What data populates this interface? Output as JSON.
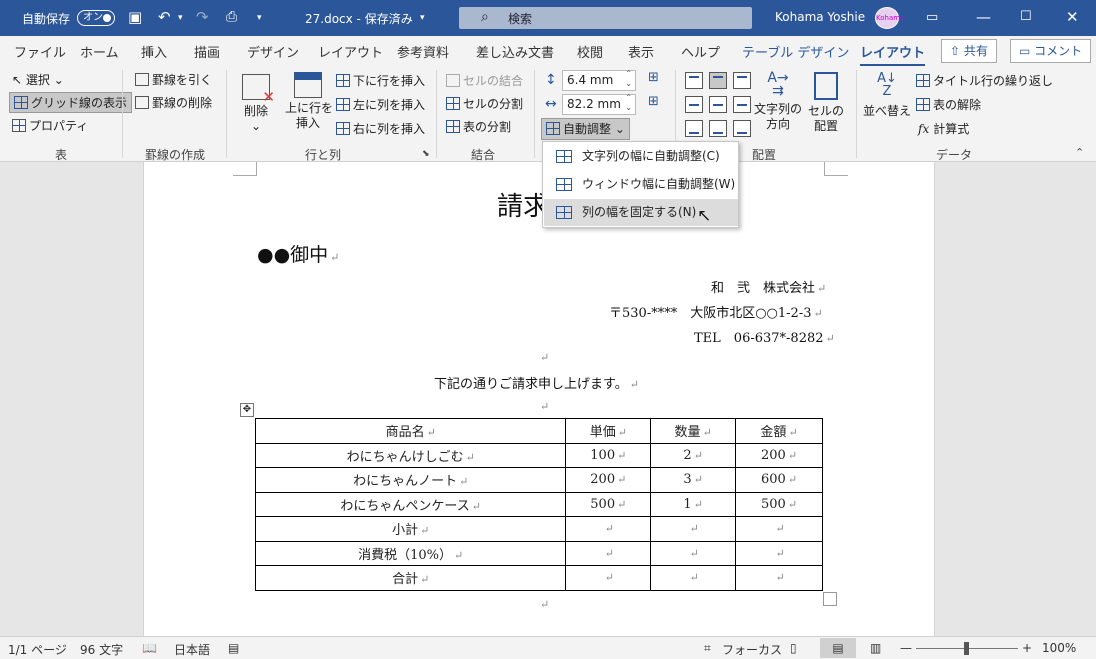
{
  "titlebar": {
    "autosave_label": "自動保存",
    "autosave_state": "オン",
    "doc_title": "27.docx - 保存済み",
    "search_placeholder": "検索",
    "user_name": "Kohama Yoshie",
    "avatar_text": "Kohama"
  },
  "tabs": [
    "ファイル",
    "ホーム",
    "挿入",
    "描画",
    "デザイン",
    "レイアウト",
    "参考資料",
    "差し込み文書",
    "校閲",
    "表示",
    "ヘルプ",
    "テーブル デザイン",
    "レイアウト"
  ],
  "share_label": "共有",
  "comment_label": "コメント",
  "ribbon": {
    "table": {
      "select": "選択",
      "gridlines": "グリッド線の表示",
      "properties": "プロパティ",
      "group": "表"
    },
    "draw": {
      "draw_table": "罫線を引く",
      "eraser": "罫線の削除",
      "group": "罫線の作成"
    },
    "rows_cols": {
      "delete": "削除",
      "insert_above_1": "上に行を",
      "insert_above_2": "挿入",
      "insert_below": "下に行を挿入",
      "insert_left": "左に列を挿入",
      "insert_right": "右に列を挿入",
      "group": "行と列"
    },
    "merge": {
      "merge_cells": "セルの結合",
      "split_cells": "セルの分割",
      "split_table": "表の分割",
      "group": "結合"
    },
    "cell_size": {
      "height": "6.4 mm",
      "width": "82.2 mm",
      "autofit": "自動調整"
    },
    "alignment": {
      "direction_1": "文字列の",
      "direction_2": "方向",
      "margins_1": "セルの",
      "margins_2": "配置",
      "group": "配置"
    },
    "data": {
      "sort_1": "並べ替え",
      "repeat_header": "タイトル行の繰り返し",
      "convert": "表の解除",
      "formula": "計算式",
      "group": "データ"
    }
  },
  "autofit_menu": [
    {
      "label": "文字列の幅に自動調整(C)"
    },
    {
      "label": "ウィンドウ幅に自動調整(W)"
    },
    {
      "label": "列の幅を固定する(N)"
    }
  ],
  "document": {
    "title": "請求",
    "addressee": "●●御中",
    "company": "和　弐　株式会社",
    "address": "〒530-****　大阪市北区○○1-2-3",
    "tel": "TEL　06-637*-8282",
    "intro": "下記の通りご請求申し上げます。",
    "table_headers": [
      "商品名",
      "単価",
      "数量",
      "金額"
    ],
    "table_rows": [
      [
        "わにちゃんけしごむ",
        "100",
        "2",
        "200"
      ],
      [
        "わにちゃんノート",
        "200",
        "3",
        "600"
      ],
      [
        "わにちゃんペンケース",
        "500",
        "1",
        "500"
      ],
      [
        "小計",
        "",
        "",
        ""
      ],
      [
        "消費税（10%）",
        "",
        "",
        ""
      ],
      [
        "合計",
        "",
        "",
        ""
      ]
    ]
  },
  "statusbar": {
    "page": "1/1 ページ",
    "words": "96 文字",
    "language": "日本語",
    "focus": "フォーカス",
    "zoom": "100%"
  }
}
